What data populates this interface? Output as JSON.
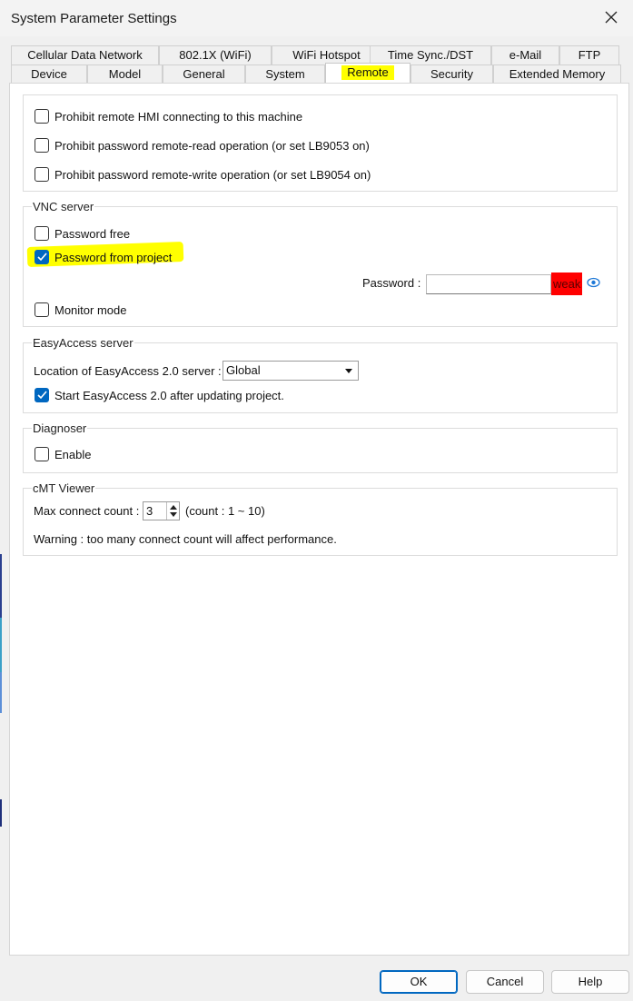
{
  "window": {
    "title": "System Parameter Settings"
  },
  "tabs": {
    "row1": [
      "Cellular Data Network",
      "802.1X (WiFi)",
      "WiFi Hotspot",
      "Time Sync./DST",
      "e-Mail",
      "FTP"
    ],
    "row2": [
      "Device",
      "Model",
      "General",
      "System",
      "Remote",
      "Security",
      "Extended Memory"
    ],
    "active": "Remote"
  },
  "remote_access": {
    "items": [
      {
        "label": "Prohibit remote HMI connecting to this machine",
        "checked": false
      },
      {
        "label": "Prohibit password remote-read operation (or set LB9053 on)",
        "checked": false
      },
      {
        "label": "Prohibit password remote-write operation (or set LB9054 on)",
        "checked": false
      }
    ]
  },
  "vnc": {
    "title": "VNC server",
    "password_free": {
      "label": "Password free",
      "checked": false
    },
    "password_from_project": {
      "label": "Password from project",
      "checked": true
    },
    "password_label": "Password :",
    "password_value": "",
    "strength": "weak",
    "strength_color": "#ff0000",
    "monitor_mode": {
      "label": "Monitor mode",
      "checked": false
    }
  },
  "easyaccess": {
    "title": "EasyAccess server",
    "location_label": "Location of EasyAccess 2.0 server :",
    "location_value": "Global",
    "start_after_update": {
      "label": "Start EasyAccess 2.0 after updating project.",
      "checked": true
    }
  },
  "diagnoser": {
    "title": "Diagnoser",
    "enable": {
      "label": "Enable",
      "checked": false
    }
  },
  "cmt_viewer": {
    "title": "cMT Viewer",
    "max_connect_label": "Max connect count :",
    "max_connect_value": "3",
    "range_text": "(count : 1 ~ 10)",
    "warning": "Warning : too many connect count will affect performance."
  },
  "buttons": {
    "ok": "OK",
    "cancel": "Cancel",
    "help": "Help"
  },
  "colors": {
    "accent": "#0067c0",
    "highlight": "#ffff00"
  }
}
